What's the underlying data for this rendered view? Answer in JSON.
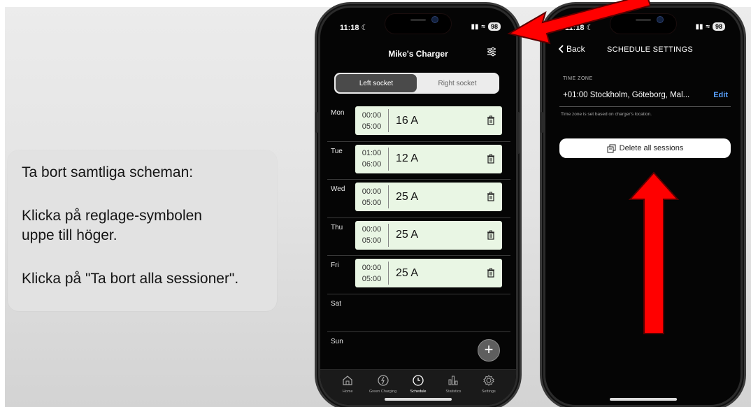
{
  "instructions": {
    "line1": "Ta bort samtliga scheman:",
    "line2": "Klicka på reglage-symbolen",
    "line3": "uppe till höger.",
    "line4": "Klicka på \"Ta bort alla sessioner\"."
  },
  "phone1": {
    "status_time": "11:18",
    "battery": "98",
    "title": "Mike's Charger",
    "tabs": [
      "Left socket",
      "Right socket"
    ],
    "active_socket_tab": "Left socket",
    "days": [
      {
        "name": "Mon",
        "start": "00:00",
        "end": "05:00",
        "amps": "16 A"
      },
      {
        "name": "Tue",
        "start": "01:00",
        "end": "06:00",
        "amps": "12 A"
      },
      {
        "name": "Wed",
        "start": "00:00",
        "end": "05:00",
        "amps": "25 A"
      },
      {
        "name": "Thu",
        "start": "00:00",
        "end": "05:00",
        "amps": "25 A"
      },
      {
        "name": "Fri",
        "start": "00:00",
        "end": "05:00",
        "amps": "25 A"
      },
      {
        "name": "Sat"
      },
      {
        "name": "Sun"
      }
    ],
    "fab_label": "+",
    "bottom_nav": [
      "Home",
      "Green Charging",
      "Schedule",
      "Statistics",
      "Settings"
    ],
    "active_nav": "Schedule",
    "icons": {
      "settings_icon": "sliders-icon",
      "trash": "trash-icon",
      "add": "plus-icon"
    }
  },
  "phone2": {
    "status_time": "11:18",
    "battery": "98",
    "back_label": "Back",
    "title": "SCHEDULE SETTINGS",
    "timezone_label": "TIME ZONE",
    "timezone_value": "+01:00  Stockholm, Göteborg, Mal...",
    "edit_label": "Edit",
    "timezone_note": "Time zone is set based on charger's location.",
    "delete_button": "Delete all sessions"
  },
  "colors": {
    "arrow": "#ff0000",
    "schedule_card": "#e9f6e4",
    "edit_link": "#5aa2ff"
  }
}
